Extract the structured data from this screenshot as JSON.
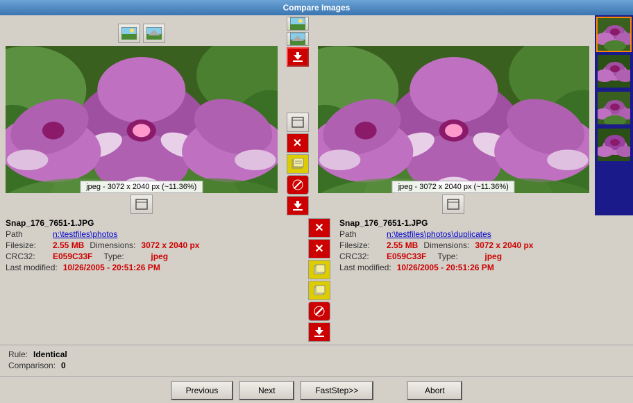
{
  "window": {
    "title": "Compare Images"
  },
  "left_image": {
    "filename": "Snap_176_7651-1.JPG",
    "path_label": "Path",
    "path_value": "n:\\testfiles\\photos",
    "filesize_label": "Filesize:",
    "filesize_value": "2.55 MB",
    "dimensions_label": "Dimensions:",
    "dimensions_value": "3072 x 2040 px",
    "crc32_label": "CRC32:",
    "crc32_value": "E059C33F",
    "type_label": "Type:",
    "type_value": "jpeg",
    "modified_label": "Last modified:",
    "modified_value": "10/26/2005 - 20:51:26 PM",
    "tooltip": "jpeg - 3072 x 2040 px (~11.36%)"
  },
  "right_image": {
    "filename": "Snap_176_7651-1.JPG",
    "path_label": "Path",
    "path_value": "n:\\testfiles\\photos\\duplicates",
    "filesize_label": "Filesize:",
    "filesize_value": "2.55 MB",
    "dimensions_label": "Dimensions:",
    "dimensions_value": "3072 x 2040 px",
    "crc32_label": "CRC32:",
    "crc32_value": "E059C33F",
    "type_label": "Type:",
    "type_value": "jpeg",
    "modified_label": "Last modified:",
    "modified_value": "10/26/2005 - 20:51:26 PM",
    "tooltip": "jpeg - 3072 x 2040 px (~11.36%)"
  },
  "bottom": {
    "rule_label": "Rule:",
    "rule_value": "Identical",
    "comparison_label": "Comparison:",
    "comparison_value": "0"
  },
  "buttons": {
    "previous": "Previous",
    "next": "Next",
    "faststep": "FastStep>>",
    "abort": "Abort"
  },
  "toolbar": {
    "left_panel_btn1_icon": "🖼",
    "left_panel_btn2_icon": "🖼",
    "resize_icon": "⬜",
    "delete_icon": "✕",
    "move_icon": "📋",
    "block_icon": "🚫",
    "download_icon": "⬇"
  }
}
